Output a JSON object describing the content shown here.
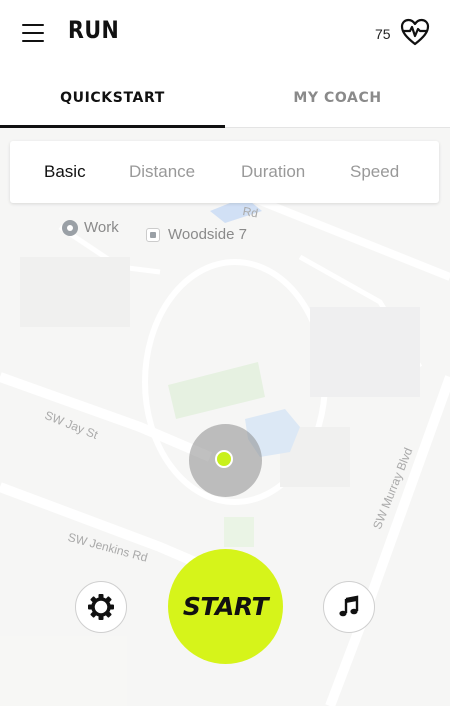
{
  "header": {
    "title": "RUN",
    "heart_rate": "75",
    "menu_icon": "hamburger-menu-icon",
    "heart_icon": "heart-rate-icon"
  },
  "tabs": [
    {
      "label": "QUICKSTART",
      "active": true
    },
    {
      "label": "MY COACH",
      "active": false
    }
  ],
  "run_types": [
    {
      "label": "Basic",
      "active": true
    },
    {
      "label": "Distance",
      "active": false
    },
    {
      "label": "Duration",
      "active": false
    },
    {
      "label": "Speed",
      "active": false
    }
  ],
  "map": {
    "pois": [
      {
        "label": "Work",
        "icon": "briefcase-pin-icon"
      },
      {
        "label": "Woodside 7",
        "icon": "building-pin-icon"
      }
    ],
    "streets": [
      "SW Jay St",
      "SW Jenkins Rd",
      "SW Murray Blvd",
      "Rd"
    ]
  },
  "controls": {
    "start_label": "START",
    "settings_icon": "gear-icon",
    "music_icon": "music-note-icon"
  },
  "colors": {
    "accent": "#d6f41a",
    "text_primary": "#111111",
    "text_muted": "#999999"
  }
}
